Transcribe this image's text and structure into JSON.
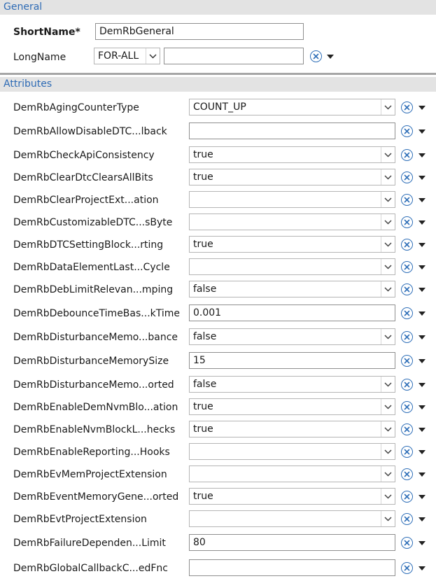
{
  "general": {
    "header": "General",
    "short_name_label": "ShortName*",
    "short_name_value": "DemRbGeneral",
    "long_name_label": "LongName",
    "long_name_lang": "FOR-ALL",
    "long_name_value": ""
  },
  "attributes": {
    "header": "Attributes",
    "rows": [
      {
        "label": "DemRbAgingCounterType",
        "type": "select",
        "value": "COUNT_UP"
      },
      {
        "label": "DemRbAllowDisableDTC...lback",
        "type": "text",
        "value": ""
      },
      {
        "label": "DemRbCheckApiConsistency",
        "type": "select",
        "value": "true"
      },
      {
        "label": "DemRbClearDtcClearsAllBits",
        "type": "select",
        "value": "true"
      },
      {
        "label": "DemRbClearProjectExt...ation",
        "type": "select",
        "value": ""
      },
      {
        "label": "DemRbCustomizableDTC...sByte",
        "type": "select",
        "value": ""
      },
      {
        "label": "DemRbDTCSettingBlock...rting",
        "type": "select",
        "value": "true"
      },
      {
        "label": "DemRbDataElementLast...Cycle",
        "type": "select",
        "value": ""
      },
      {
        "label": "DemRbDebLimitRelevan...mping",
        "type": "select",
        "value": "false"
      },
      {
        "label": "DemRbDebounceTimeBas...kTime",
        "type": "text",
        "value": "0.001"
      },
      {
        "label": "DemRbDisturbanceMemo...bance",
        "type": "select",
        "value": "false"
      },
      {
        "label": "DemRbDisturbanceMemorySize",
        "type": "text",
        "value": "15"
      },
      {
        "label": "DemRbDisturbanceMemo...orted",
        "type": "select",
        "value": "false"
      },
      {
        "label": "DemRbEnableDemNvmBlo...ation",
        "type": "select",
        "value": "true"
      },
      {
        "label": "DemRbEnableNvmBlockL...hecks",
        "type": "select",
        "value": "true"
      },
      {
        "label": "DemRbEnableReporting...Hooks",
        "type": "select",
        "value": ""
      },
      {
        "label": "DemRbEvMemProjectExtension",
        "type": "select",
        "value": ""
      },
      {
        "label": "DemRbEventMemoryGene...orted",
        "type": "select",
        "value": "true"
      },
      {
        "label": "DemRbEvtProjectExtension",
        "type": "select",
        "value": ""
      },
      {
        "label": "DemRbFailureDependen...Limit",
        "type": "text",
        "value": "80"
      },
      {
        "label": "DemRbGlobalCallbackC...edFnc",
        "type": "text",
        "value": ""
      }
    ]
  },
  "icons": {
    "clear": "clear-value-icon",
    "menu": "menu-arrow-icon",
    "dropdown": "chevron-down-icon"
  },
  "colors": {
    "accent": "#2e6bb5",
    "header_bg": "#e3e3e3",
    "separator": "#a6a6a6"
  }
}
